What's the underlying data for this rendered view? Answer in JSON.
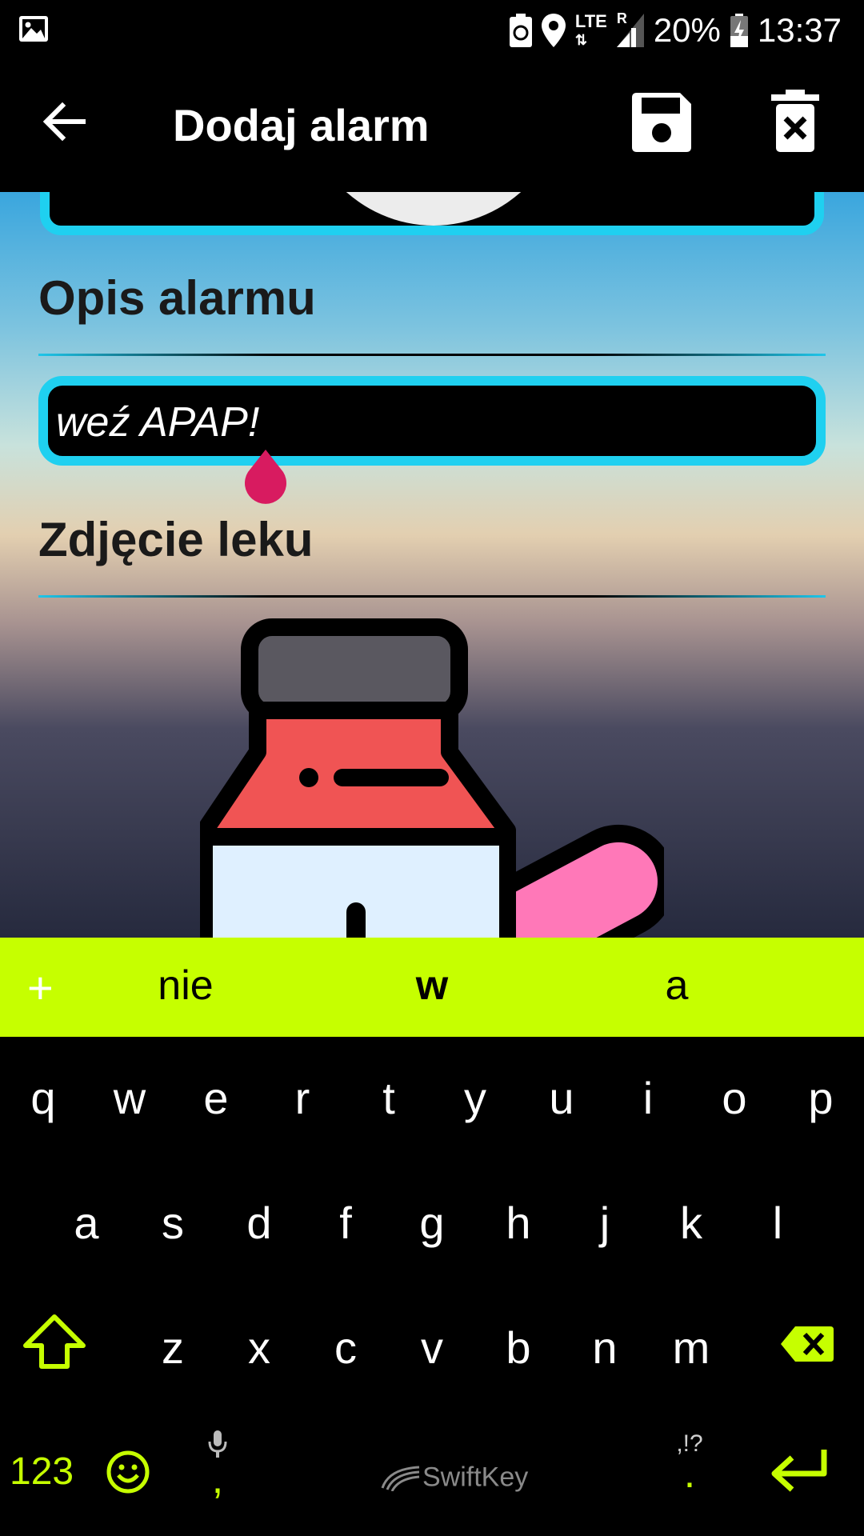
{
  "status_bar": {
    "network": "LTE",
    "roaming": "R",
    "battery": "20%",
    "time": "13:37"
  },
  "app_bar": {
    "title": "Dodaj alarm",
    "icons": [
      "back-arrow-icon",
      "save-icon",
      "delete-icon"
    ]
  },
  "form": {
    "description_title": "Opis alarmu",
    "description_value": "weź APAP!",
    "photo_title": "Zdjęcie leku"
  },
  "keyboard": {
    "suggestions": [
      "nie",
      "w",
      "a"
    ],
    "row1": [
      "q",
      "w",
      "e",
      "r",
      "t",
      "y",
      "u",
      "i",
      "o",
      "p"
    ],
    "row2": [
      "a",
      "s",
      "d",
      "f",
      "g",
      "h",
      "j",
      "k",
      "l"
    ],
    "row3": [
      "z",
      "x",
      "c",
      "v",
      "b",
      "n",
      "m"
    ],
    "numbers_key": "123",
    "comma_key": ",",
    "period_symbols": ",!?",
    "period_key": ".",
    "brand": "SwiftKey",
    "accent_color": "#c6ff00"
  },
  "colors": {
    "input_border": "#1fd0f0",
    "handle": "#d81b60"
  }
}
